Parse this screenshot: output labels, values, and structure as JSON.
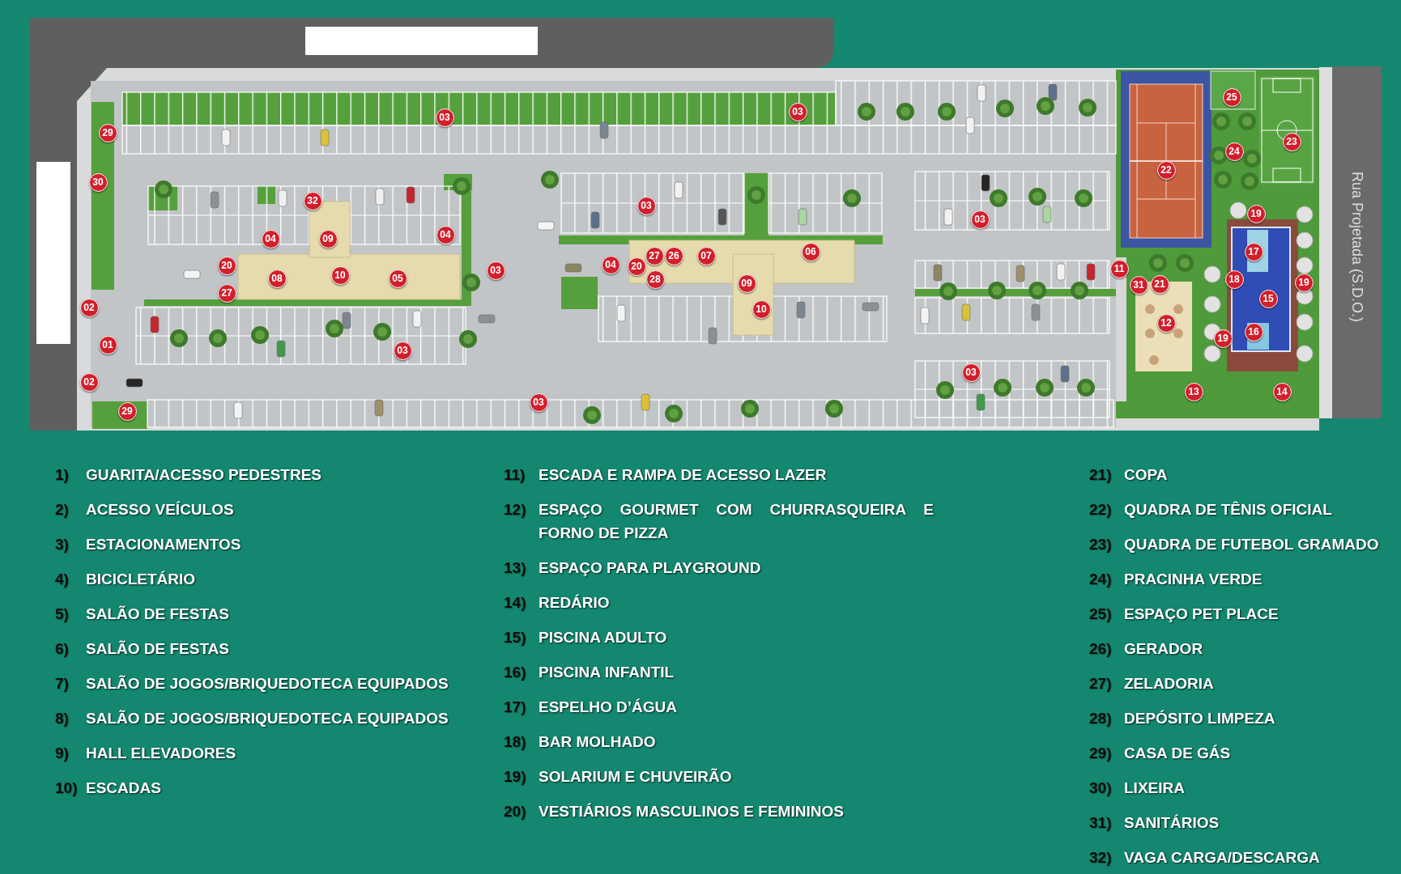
{
  "site_plan": {
    "road_label": "Rua Projetada (S.D.O.)",
    "markers": [
      "29",
      "03",
      "03",
      "25",
      "23",
      "24",
      "22",
      "30",
      "32",
      "03",
      "03",
      "19",
      "04",
      "09",
      "04",
      "20",
      "08",
      "10",
      "05",
      "03",
      "04",
      "20",
      "27",
      "26",
      "28",
      "07",
      "06",
      "09",
      "11",
      "31",
      "21",
      "17",
      "18",
      "19",
      "15",
      "27",
      "02",
      "10",
      "12",
      "16",
      "19",
      "01",
      "03",
      "03",
      "02",
      "13",
      "14",
      "03",
      "29"
    ]
  },
  "legend": {
    "columns": [
      {
        "items": [
          {
            "number": "1)",
            "label": "GUARITA/ACESSO PEDESTRES"
          },
          {
            "number": "2)",
            "label": "ACESSO VEÍCULOS"
          },
          {
            "number": "3)",
            "label": "ESTACIONAMENTOS"
          },
          {
            "number": "4)",
            "label": "BICICLETÁRIO"
          },
          {
            "number": "5)",
            "label": "SALÃO DE FESTAS"
          },
          {
            "number": "6)",
            "label": "SALÃO DE FESTAS"
          },
          {
            "number": "7)",
            "label": "SALÃO DE JOGOS/BRIQUEDOTECA EQUIPADOS"
          },
          {
            "number": "8)",
            "label": "SALÃO DE JOGOS/BRIQUEDOTECA EQUIPADOS"
          },
          {
            "number": "9)",
            "label": "HALL ELEVADORES"
          },
          {
            "number": "10)",
            "label": "ESCADAS"
          }
        ]
      },
      {
        "items": [
          {
            "number": "11)",
            "label": "ESCADA E RAMPA DE ACESSO LAZER"
          },
          {
            "number": "12)",
            "label": "ESPAÇO GOURMET COM CHURRASQUEIRA E FORNO DE PIZZA"
          },
          {
            "number": "13)",
            "label": "ESPAÇO PARA PLAYGROUND"
          },
          {
            "number": "14)",
            "label": "REDÁRIO"
          },
          {
            "number": "15)",
            "label": "PISCINA ADULTO"
          },
          {
            "number": "16)",
            "label": "PISCINA INFANTIL"
          },
          {
            "number": "17)",
            "label": "ESPELHO D’ÁGUA"
          },
          {
            "number": "18)",
            "label": "BAR MOLHADO"
          },
          {
            "number": "19)",
            "label": "SOLARIUM E CHUVEIRÃO"
          },
          {
            "number": "20)",
            "label": "VESTIÁRIOS MASCULINOS E FEMININOS"
          }
        ]
      },
      {
        "items": [
          {
            "number": "21)",
            "label": "COPA"
          },
          {
            "number": "22)",
            "label": "QUADRA DE TÊNIS OFICIAL"
          },
          {
            "number": "23)",
            "label": "QUADRA DE FUTEBOL GRAMADO"
          },
          {
            "number": "24)",
            "label": "PRACINHA VERDE"
          },
          {
            "number": "25)",
            "label": "ESPAÇO PET PLACE"
          },
          {
            "number": "26)",
            "label": "GERADOR"
          },
          {
            "number": "27)",
            "label": "ZELADORIA"
          },
          {
            "number": "28)",
            "label": "DEPÓSITO LIMPEZA"
          },
          {
            "number": "29)",
            "label": "CASA DE GÁS"
          },
          {
            "number": "30)",
            "label": "LIXEIRA"
          },
          {
            "number": "31)",
            "label": "SANITÁRIOS"
          },
          {
            "number": "32)",
            "label": "VAGA CARGA/DESCARGA"
          }
        ]
      }
    ]
  }
}
